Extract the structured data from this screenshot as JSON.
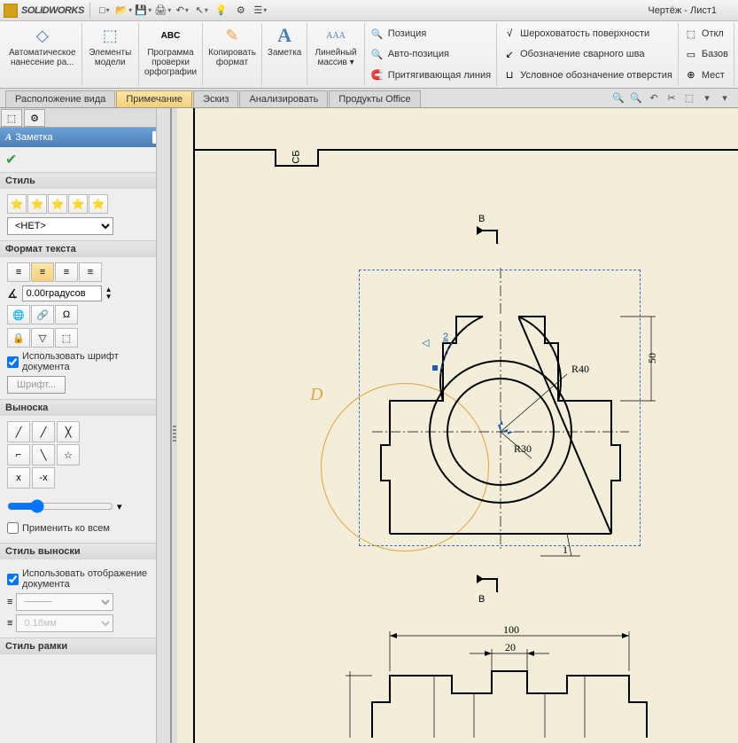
{
  "app": {
    "name": "SOLIDWORKS",
    "doc_title": "Чертёж - Лист1"
  },
  "qat": {
    "new": "□",
    "open": "📂",
    "save": "💾",
    "print": "🖨",
    "undo": "↶",
    "select": "↖",
    "rebuild": "💡",
    "options": "⚙",
    "props": "☰"
  },
  "ribbon": {
    "auto_dim": {
      "label": "Автоматическое нанесение ра..."
    },
    "model_items": {
      "label": "Элементы модели"
    },
    "spellcheck": {
      "label": "Программа проверки орфографии",
      "abc": "ABC"
    },
    "copy_format": {
      "label": "Копировать формат"
    },
    "note": {
      "label": "Заметка",
      "A": "A"
    },
    "linear_pattern": {
      "label": "Линейный массив ▾",
      "AAA": "AAA"
    },
    "col1": {
      "position": "Позиция",
      "autopos": "Авто-позиция",
      "magnetic": "Притягивающая линия"
    },
    "col2": {
      "rough": "Шероховатость поверхности",
      "weld": "Обозначение сварного шва",
      "hole": "Условное обозначение отверстия"
    },
    "col3": {
      "devflag": "Откл",
      "base": "Базов",
      "loc": "Мест"
    }
  },
  "tabs": [
    "Расположение вида",
    "Примечание",
    "Эскиз",
    "Анализировать",
    "Продукты Office"
  ],
  "active_tab": 1,
  "panel": {
    "title": "Заметка",
    "style": {
      "head": "Стиль",
      "select": "<НЕТ>"
    },
    "text_format": {
      "head": "Формат текста",
      "angle": "0.00градусов",
      "use_doc_font": "Использовать шрифт документа",
      "font_btn": "Шрифт..."
    },
    "leader": {
      "head": "Выноска",
      "apply_all": "Применить ко всем"
    },
    "leader_style": {
      "head": "Стиль выноски",
      "use_doc": "Использовать отображение документа",
      "thick": "0.18мм"
    },
    "frame_style": {
      "head": "Стиль рамки"
    }
  },
  "drawing": {
    "box_tag": "СБ",
    "section_top": "В",
    "section_bottom": "В",
    "detail": "D",
    "balloon": "2",
    "balloon_num": "1",
    "r1": "R40",
    "r2": "R30",
    "dim50": "50",
    "dim100": "100",
    "dim20": "20"
  }
}
